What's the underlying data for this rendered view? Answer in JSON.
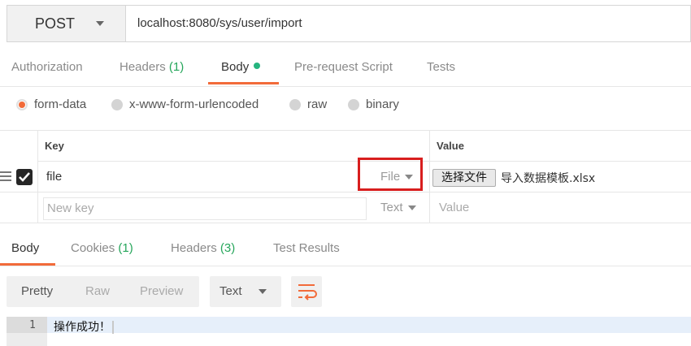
{
  "request": {
    "method": "POST",
    "url": "localhost:8080/sys/user/import"
  },
  "request_tabs": [
    {
      "label": "Authorization",
      "count": ""
    },
    {
      "label": "Headers",
      "count": "(1)"
    },
    {
      "label": "Body",
      "count": "",
      "active": true
    },
    {
      "label": "Pre-request Script",
      "count": ""
    },
    {
      "label": "Tests",
      "count": ""
    }
  ],
  "body_types": [
    {
      "label": "form-data",
      "selected": true
    },
    {
      "label": "x-www-form-urlencoded",
      "selected": false
    },
    {
      "label": "raw",
      "selected": false
    },
    {
      "label": "binary",
      "selected": false
    }
  ],
  "kv_table": {
    "headers": {
      "key": "Key",
      "value": "Value"
    },
    "rows": [
      {
        "checked": true,
        "key": "file",
        "type": "File",
        "file_button": "选择文件",
        "file_name": "导入数据模板.xlsx"
      }
    ],
    "new_row": {
      "key_placeholder": "New key",
      "type": "Text",
      "value_placeholder": "Value"
    }
  },
  "response_tabs": [
    {
      "label": "Body",
      "count": "",
      "active": true
    },
    {
      "label": "Cookies",
      "count": "(1)"
    },
    {
      "label": "Headers",
      "count": "(3)"
    },
    {
      "label": "Test Results",
      "count": ""
    }
  ],
  "response_toolbar": {
    "views": [
      "Pretty",
      "Raw",
      "Preview"
    ],
    "active_view": "Pretty",
    "format": "Text"
  },
  "response_body": {
    "lines": [
      {
        "num": "1",
        "text": "操作成功！"
      }
    ]
  },
  "colors": {
    "accent": "#f26b3a",
    "count": "#26a65b",
    "highlight": "#d81e1e"
  }
}
